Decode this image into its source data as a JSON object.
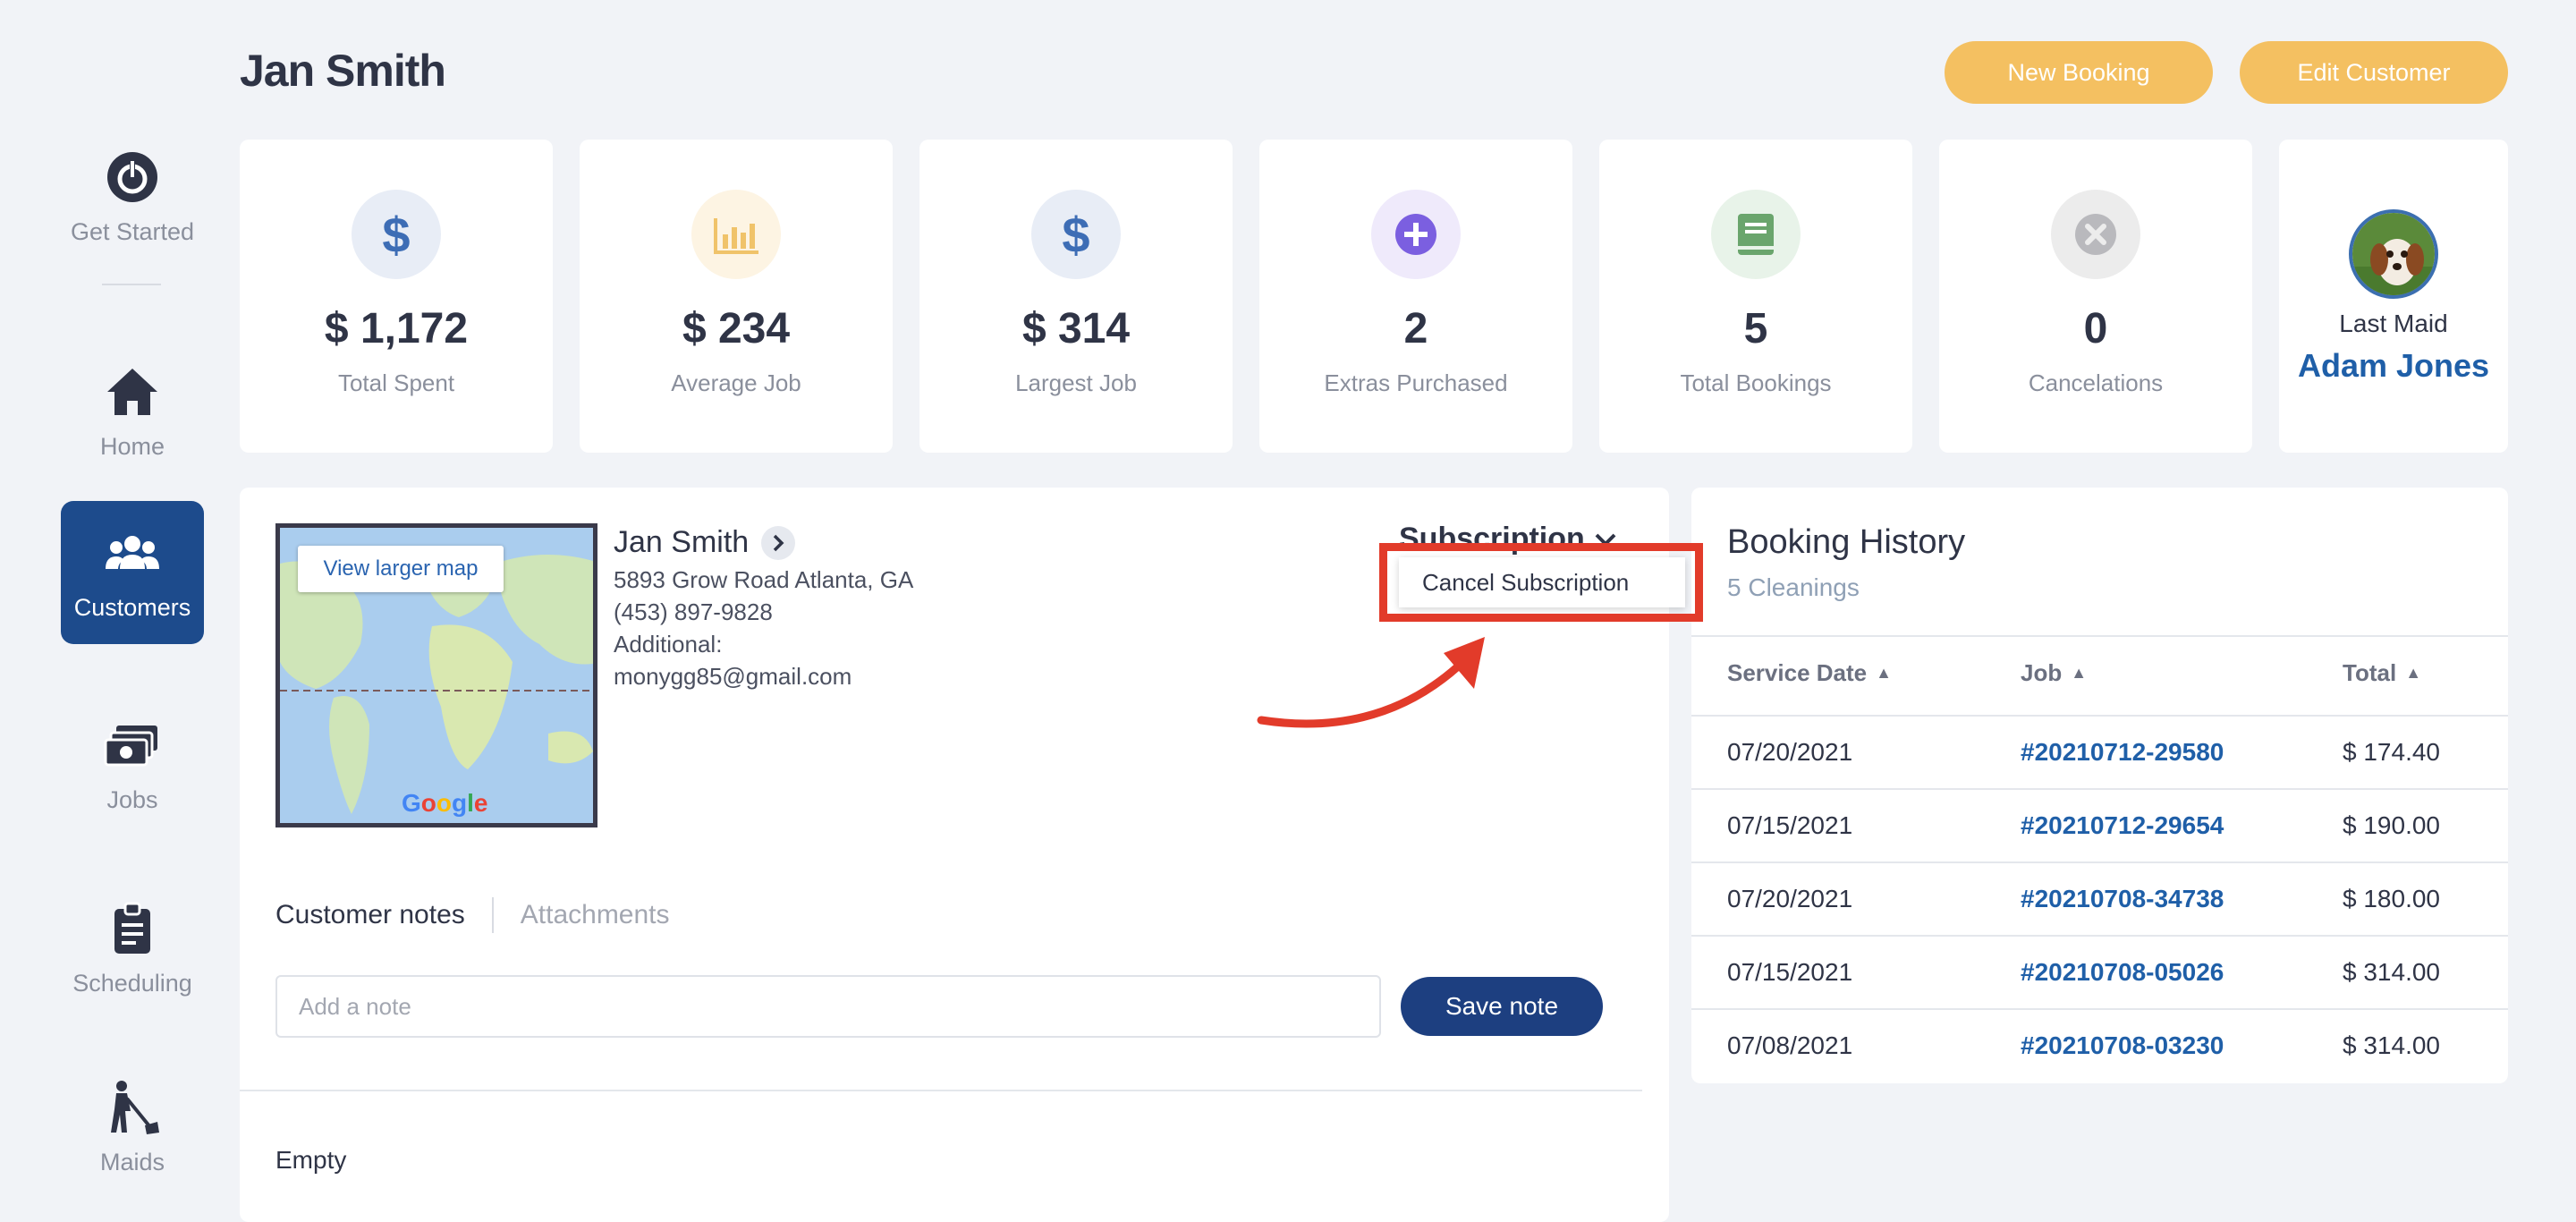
{
  "header": {
    "title": "Jan Smith",
    "new_booking": "New Booking",
    "edit_customer": "Edit Customer"
  },
  "sidebar": {
    "items": [
      {
        "label": "Get Started",
        "icon": "power-icon"
      },
      {
        "label": "Home",
        "icon": "home-icon"
      },
      {
        "label": "Customers",
        "icon": "users-icon",
        "active": true
      },
      {
        "label": "Jobs",
        "icon": "money-stack-icon"
      },
      {
        "label": "Scheduling",
        "icon": "clipboard-icon"
      },
      {
        "label": "Maids",
        "icon": "cleaner-icon"
      }
    ]
  },
  "stats": [
    {
      "value": "$ 1,172",
      "label": "Total Spent",
      "icon": "dollar-icon"
    },
    {
      "value": "$ 234",
      "label": "Average Job",
      "icon": "chart-icon"
    },
    {
      "value": "$ 314",
      "label": "Largest Job",
      "icon": "dollar-icon"
    },
    {
      "value": "2",
      "label": "Extras Purchased",
      "icon": "plus-icon"
    },
    {
      "value": "5",
      "label": "Total Bookings",
      "icon": "book-icon"
    },
    {
      "value": "0",
      "label": "Cancelations",
      "icon": "x-circle-icon"
    }
  ],
  "last_maid": {
    "label": "Last Maid",
    "name": "Adam Jones"
  },
  "customer": {
    "name": "Jan Smith",
    "address": "5893 Grow Road Atlanta, GA",
    "phone": "(453) 897-9828",
    "additional": "Additional:",
    "email": "monygg85@gmail.com",
    "map_button": "View larger map",
    "map_logo": "Google",
    "subscription_label": "Subscription",
    "subscription_menu": [
      "Cancel Subscription"
    ]
  },
  "notes": {
    "tab_notes": "Customer notes",
    "tab_attachments": "Attachments",
    "placeholder": "Add a note",
    "save_label": "Save note",
    "empty": "Empty"
  },
  "booking_history": {
    "title": "Booking History",
    "subtitle": "5 Cleanings",
    "columns": [
      "Service Date",
      "Job",
      "Total"
    ],
    "rows": [
      {
        "date": "07/20/2021",
        "job": "#20210712-29580",
        "total": "$ 174.40"
      },
      {
        "date": "07/15/2021",
        "job": "#20210712-29654",
        "total": "$ 190.00"
      },
      {
        "date": "07/20/2021",
        "job": "#20210708-34738",
        "total": "$ 180.00"
      },
      {
        "date": "07/15/2021",
        "job": "#20210708-05026",
        "total": "$ 314.00"
      },
      {
        "date": "07/08/2021",
        "job": "#20210708-03230",
        "total": "$ 314.00"
      }
    ]
  },
  "colors": {
    "accent": "#f4c061",
    "primary": "#1d4b8c",
    "link": "#1f5fa8",
    "highlight": "#e23b2a"
  }
}
